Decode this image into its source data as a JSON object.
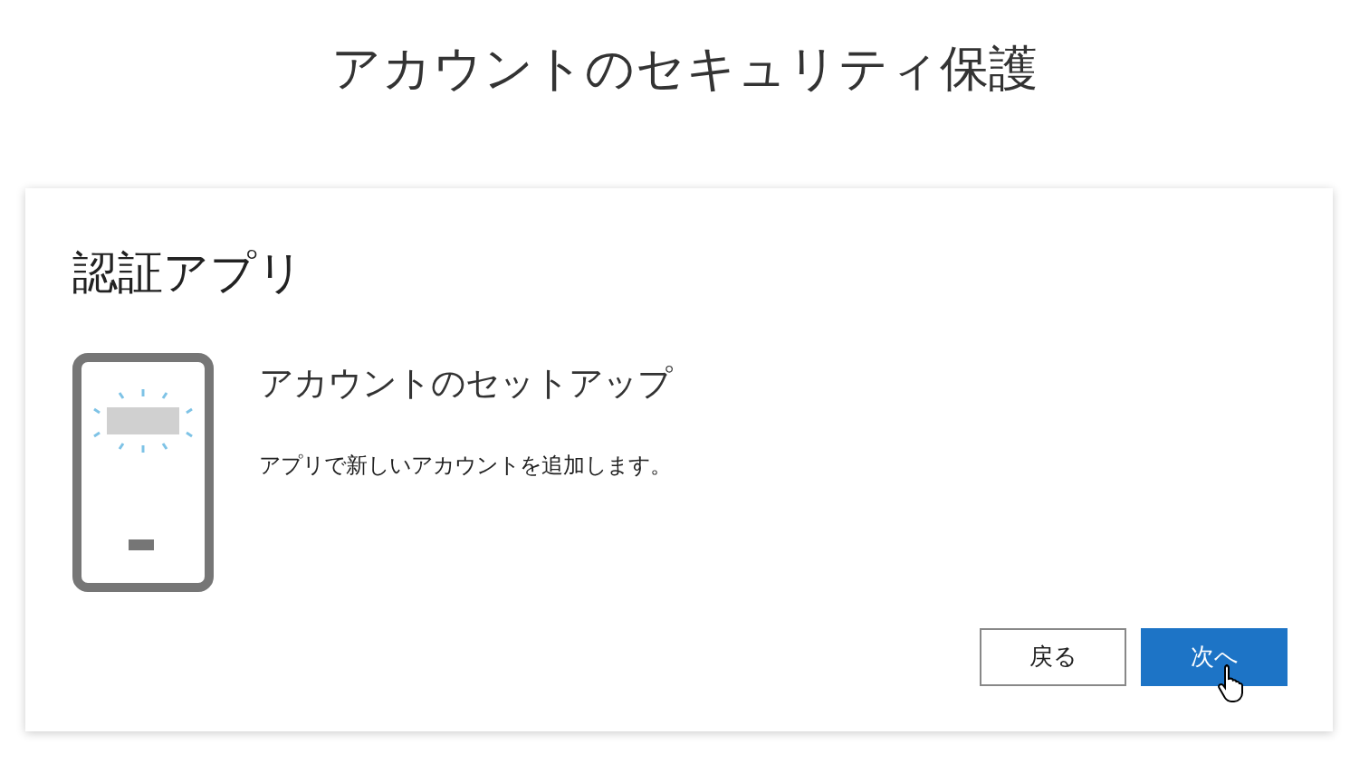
{
  "page": {
    "title": "アカウントのセキュリティ保護"
  },
  "card": {
    "heading": "認証アプリ",
    "step_title": "アカウントのセットアップ",
    "description": "アプリで新しいアカウントを追加します。"
  },
  "buttons": [
    {
      "label": "戻る",
      "kind": "secondary"
    },
    {
      "label": "次へ",
      "kind": "primary"
    }
  ]
}
